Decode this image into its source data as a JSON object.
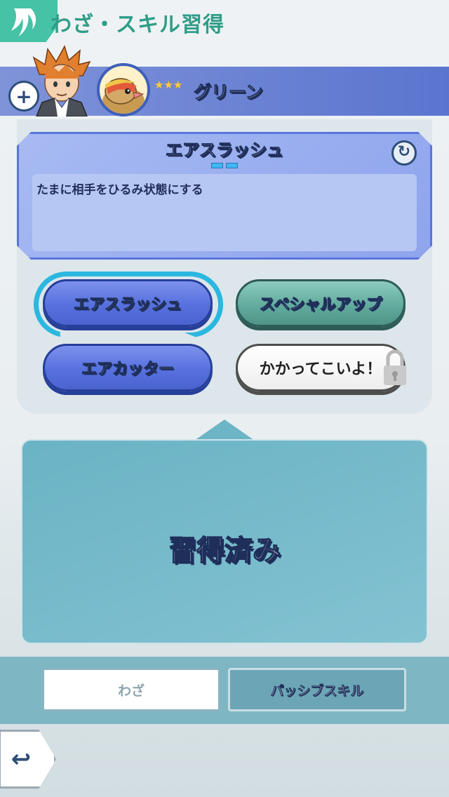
{
  "header": {
    "title": "わざ・スキル習得",
    "icon": "trainer-badge-icon"
  },
  "trainer": {
    "name": "グリーン",
    "stars": "★★★",
    "rarity": 3,
    "add_icon": "+",
    "pokemon_icon": "pidgeot-icon"
  },
  "move_info": {
    "name": "エアスラッシュ",
    "description": "たまに相手をひるみ状態にする",
    "refresh_icon": "↻",
    "gauge_segments": 2
  },
  "moves": [
    {
      "label": "エアスラッシュ",
      "style": "blue",
      "selected": true
    },
    {
      "label": "スペシャルアップ",
      "style": "teal",
      "selected": false
    },
    {
      "label": "エアカッター",
      "style": "blue",
      "selected": false
    },
    {
      "label": "かかってこいよ！",
      "style": "white",
      "selected": false,
      "locked": true
    }
  ],
  "status": {
    "text": "習得済み"
  },
  "tabs": {
    "moves": "わざ",
    "passive": "パッシブスキル"
  },
  "colors": {
    "accent": "#46c2a6",
    "band": "#5b75cf",
    "move_blue": "#5670de",
    "move_teal": "#5fa99b",
    "learned_panel": "#6ab3c5"
  },
  "back_icon": "↩"
}
